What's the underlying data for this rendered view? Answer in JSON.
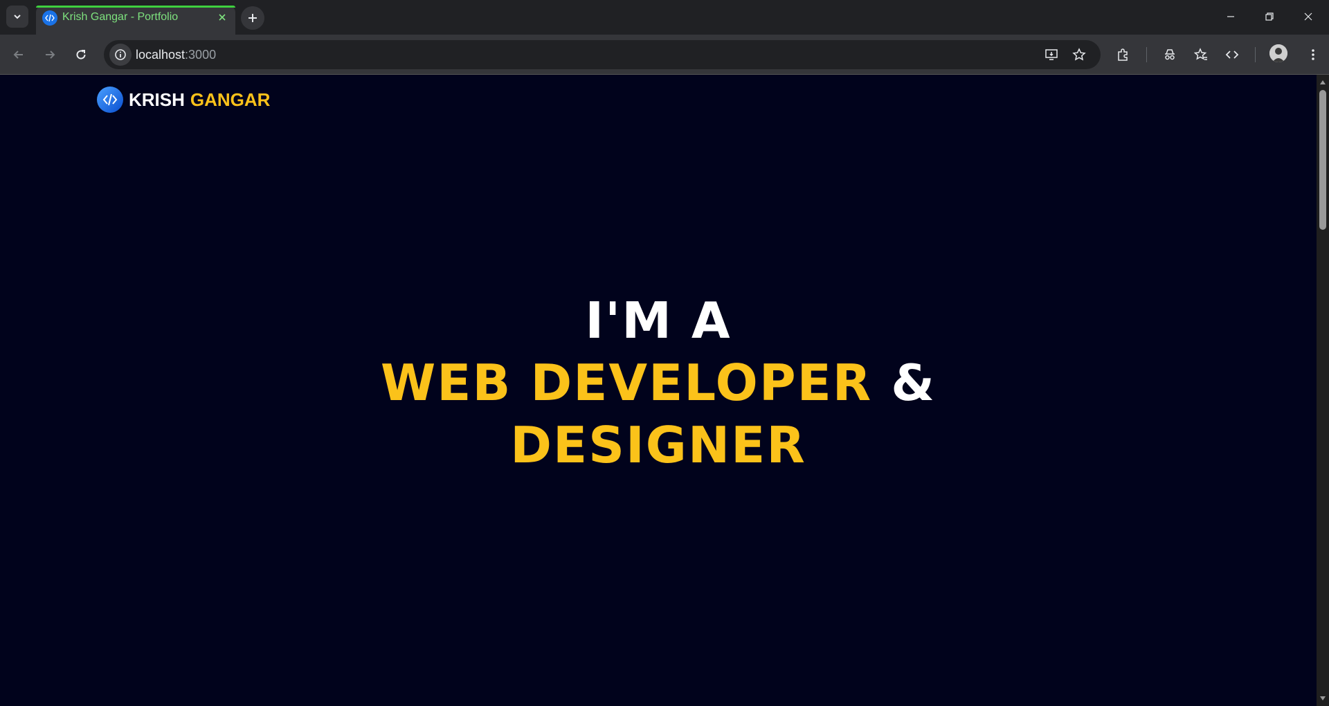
{
  "browser": {
    "tab": {
      "title": "Krish Gangar - Portfolio"
    },
    "address": {
      "host": "localhost",
      "port": ":3000"
    }
  },
  "page": {
    "brand": {
      "first": "KRISH",
      "last": "GANGAR"
    },
    "hero": {
      "line1": "I'M A",
      "line2_highlight": "WEB DEVELOPER",
      "line2_amp": "&",
      "line3": "DESIGNER"
    }
  },
  "colors": {
    "page_bg": "#01031c",
    "accent_yellow": "#fbc21a",
    "tab_accent": "#3fd13f"
  }
}
